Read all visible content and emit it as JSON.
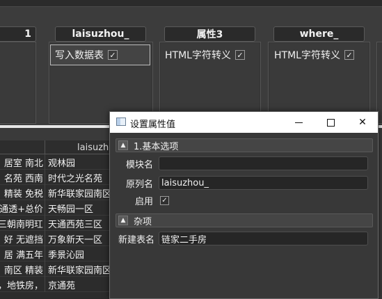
{
  "columns": [
    {
      "header": "1",
      "items": []
    },
    {
      "header": "laisuzhou_",
      "items": [
        {
          "label": "写入数据表",
          "checked": true,
          "selected": true
        }
      ]
    },
    {
      "header": "属性3",
      "items": [
        {
          "label": "HTML字符转义",
          "checked": true,
          "selected": false
        }
      ]
    },
    {
      "header": "where_",
      "items": [
        {
          "label": "HTML字符转义",
          "checked": true,
          "selected": false
        }
      ]
    }
  ],
  "check_glyph": "✓",
  "table": {
    "header_col2": "laisuzho",
    "rows": [
      {
        "c1": "居室 南北",
        "c2": "观林园"
      },
      {
        "c1": "名苑 西南",
        "c2": "时代之光名苑"
      },
      {
        "c1": "精装 免税",
        "c2": "新华联家园南区"
      },
      {
        "c1": "通透+总价",
        "c2": "天畅园一区"
      },
      {
        "c1": "三朝南明玒",
        "c2": "天通西苑三区"
      },
      {
        "c1": "好 无遮挡",
        "c2": "万象新天一区"
      },
      {
        "c1": "居 满五年",
        "c2": "季景沁园"
      },
      {
        "c1": "南区 精装",
        "c2": "新华联家园南区"
      },
      {
        "c1": "，地铁房，",
        "c2": "京通苑"
      }
    ]
  },
  "dialog": {
    "title": "设置属性值",
    "minimize_label": "–",
    "maximize_label": "□",
    "close_label": "✕",
    "sections": {
      "basic": {
        "label": "1.基本选项",
        "toggle": "▲"
      },
      "misc": {
        "label": "杂项",
        "toggle": "▲"
      }
    },
    "fields": {
      "module_name": {
        "label": "模块名",
        "value": ""
      },
      "original_column": {
        "label": "原列名",
        "value": "laisuzhou_"
      },
      "enabled": {
        "label": "启用",
        "checked": true
      },
      "new_table": {
        "label": "新建表名",
        "value": "链家二手房"
      }
    }
  }
}
